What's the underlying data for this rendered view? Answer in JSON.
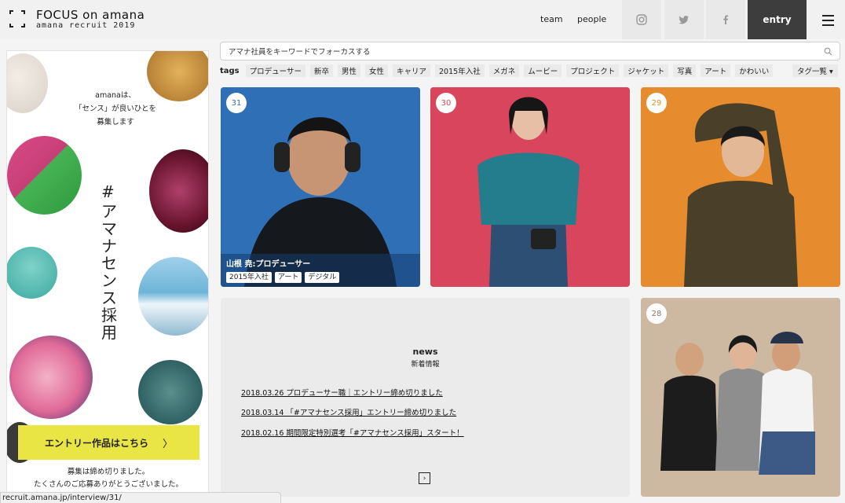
{
  "header": {
    "logo_title": "FOCUS on amana",
    "logo_sub": "amana recruit 2019",
    "nav": [
      "team",
      "people"
    ],
    "social_icons": [
      "instagram-icon",
      "twitter-icon",
      "facebook-icon"
    ],
    "entry_label": "entry"
  },
  "sidebar": {
    "copy_line1": "amanaは、",
    "copy_line2": "「センス」が良いひとを",
    "copy_line3": "募集します",
    "hash": "#",
    "vertical_title": "アマナセンス採用",
    "entry_banner": "エントリー作品はこちら",
    "closed_line1": "募集は締め切りました。",
    "closed_line2": "たくさんのご応募ありがとうございました。"
  },
  "search": {
    "placeholder": "アマナ社員をキーワードでフォーカスする"
  },
  "tags": {
    "label": "tags",
    "items": [
      "プロデューサー",
      "新卒",
      "男性",
      "女性",
      "キャリア",
      "2015年入社",
      "メガネ",
      "ムービー",
      "プロジェクト",
      "ジャケット",
      "写真",
      "アート",
      "かわいい"
    ],
    "list_label": "タグ一覧"
  },
  "cards": [
    {
      "num": "31",
      "name": "山根 尭:プロデューサー",
      "tags": [
        "2015年入社",
        "アート",
        "デジタル"
      ],
      "bg": "#2f6fb5"
    },
    {
      "num": "30",
      "bg": "#d8455d"
    },
    {
      "num": "29",
      "bg": "#e78b2f"
    },
    {
      "num": "28",
      "bg": "#cdb8a2"
    }
  ],
  "news": {
    "title": "news",
    "subtitle": "新着情報",
    "items": [
      "2018.03.26 プロデューサー職｜エントリー締め切りました",
      "2018.03.14 「#アマナセンス採用」エントリー締め切りました",
      "2018.02.16 期間限定特別選考「#アマナセンス採用」スタート！"
    ]
  },
  "status_url": "recruit.amana.jp/interview/31/",
  "colors": {
    "accent_yellow": "#e8e545",
    "entry_dark": "#3d3d3d"
  }
}
